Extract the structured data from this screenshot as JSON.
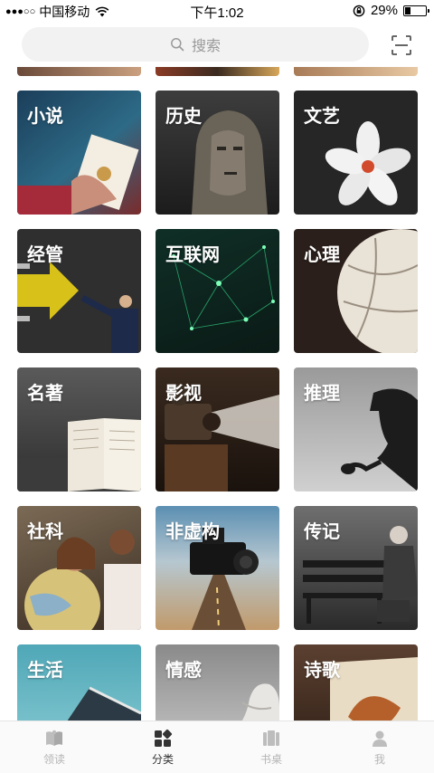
{
  "status": {
    "signal_dots": "●●●○○",
    "carrier": "中国移动",
    "time": "下午1:02",
    "battery": "29%",
    "battery_level": 0.29
  },
  "search": {
    "placeholder": "搜索"
  },
  "categories": [
    {
      "label": "小说"
    },
    {
      "label": "历史"
    },
    {
      "label": "文艺"
    },
    {
      "label": "经管"
    },
    {
      "label": "互联网"
    },
    {
      "label": "心理"
    },
    {
      "label": "名著"
    },
    {
      "label": "影视"
    },
    {
      "label": "推理"
    },
    {
      "label": "社科"
    },
    {
      "label": "非虚构"
    },
    {
      "label": "传记"
    },
    {
      "label": "生活"
    },
    {
      "label": "情感"
    },
    {
      "label": "诗歌"
    }
  ],
  "tabs": [
    {
      "label": "领读",
      "icon": "book-icon"
    },
    {
      "label": "分类",
      "icon": "category-icon"
    },
    {
      "label": "书桌",
      "icon": "bookshelf-icon"
    },
    {
      "label": "我",
      "icon": "person-icon"
    }
  ],
  "active_tab": "分类"
}
